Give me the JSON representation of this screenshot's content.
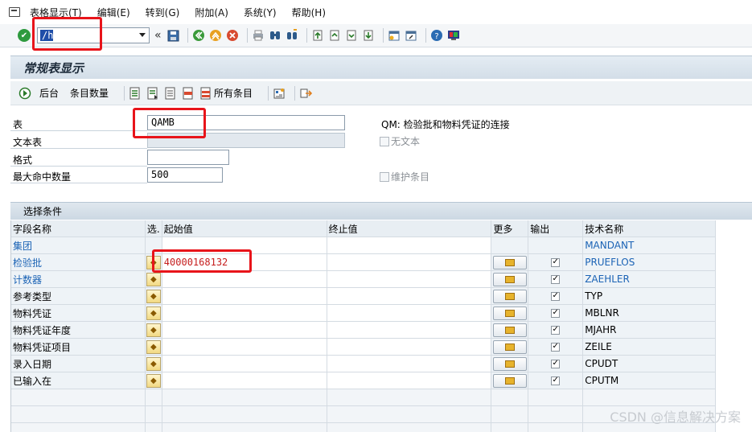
{
  "menubar": {
    "items": [
      "表格显示(T)",
      "编辑(E)",
      "转到(G)",
      "附加(A)",
      "系统(Y)",
      "帮助(H)"
    ]
  },
  "toolbar": {
    "command_value": "/h"
  },
  "title": "常规表显示",
  "app_toolbar": {
    "background_label": "后台",
    "entry_count_label": "条目数量",
    "all_entries_label": "所有条目"
  },
  "form": {
    "table_label": "表",
    "table_value": "QAMB",
    "table_desc": "QM: 检验批和物料凭证的连接",
    "text_table_label": "文本表",
    "no_text_label": "无文本",
    "format_label": "格式",
    "max_hits_label": "最大命中数量",
    "max_hits_value": "500",
    "maintain_entries_label": "维护条目"
  },
  "selection": {
    "header": "选择条件",
    "columns": [
      "字段名称",
      "选.",
      "起始值",
      "终止值",
      "更多",
      "输出",
      "技术名称"
    ],
    "rows": [
      {
        "field": "集团",
        "tech": "MANDANT",
        "blue": true,
        "sel_btn": false,
        "more": false,
        "out": false,
        "from": ""
      },
      {
        "field": "检验批",
        "tech": "PRUEFLOS",
        "blue": true,
        "sel_btn": true,
        "more": true,
        "out": true,
        "from": "40000168132"
      },
      {
        "field": "计数器",
        "tech": "ZAEHLER",
        "blue": true,
        "sel_btn": true,
        "more": true,
        "out": true,
        "from": ""
      },
      {
        "field": "参考类型",
        "tech": "TYP",
        "blue": false,
        "sel_btn": true,
        "more": true,
        "out": true,
        "from": ""
      },
      {
        "field": "物料凭证",
        "tech": "MBLNR",
        "blue": false,
        "sel_btn": true,
        "more": true,
        "out": true,
        "from": ""
      },
      {
        "field": "物料凭证年度",
        "tech": "MJAHR",
        "blue": false,
        "sel_btn": true,
        "more": true,
        "out": true,
        "from": ""
      },
      {
        "field": "物料凭证项目",
        "tech": "ZEILE",
        "blue": false,
        "sel_btn": true,
        "more": true,
        "out": true,
        "from": ""
      },
      {
        "field": "录入日期",
        "tech": "CPUDT",
        "blue": false,
        "sel_btn": true,
        "more": true,
        "out": true,
        "from": ""
      },
      {
        "field": "已输入在",
        "tech": "CPUTM",
        "blue": false,
        "sel_btn": true,
        "more": true,
        "out": true,
        "from": ""
      }
    ]
  },
  "watermark": "CSDN @信息解决方案"
}
